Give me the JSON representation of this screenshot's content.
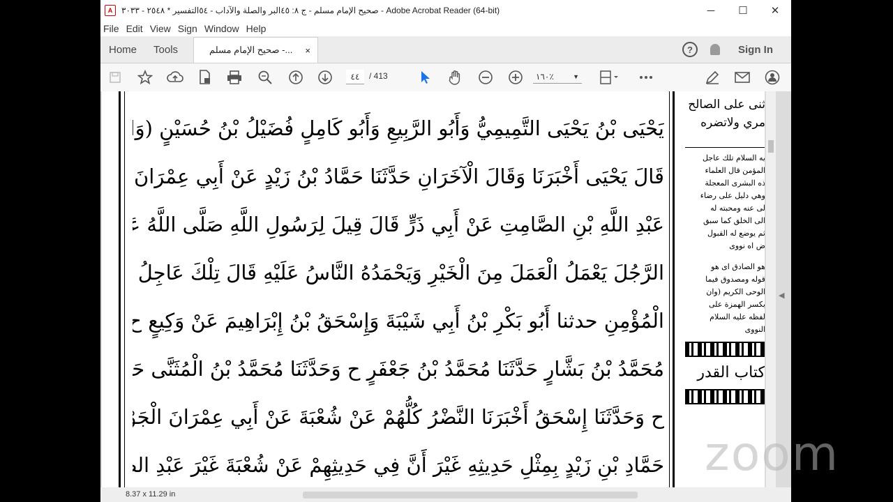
{
  "window": {
    "title": "صحيح الإمام مسلم - ج ٨: ٤٥البر والصلة والآداب - ٥٤التفسير * ٢٥٤٨ - ٣٠٣٣ - Adobe Acrobat Reader (64-bit)",
    "app_icon": "pdf-icon",
    "minimize": "─",
    "maximize": "☐",
    "close": "✕"
  },
  "menu": [
    "File",
    "Edit",
    "View",
    "Sign",
    "Window",
    "Help"
  ],
  "tabs": {
    "home": "Home",
    "tools": "Tools",
    "document": "صحيح الإمام مسلم -...",
    "document_close": "×"
  },
  "account": {
    "help": "?",
    "sign_in": "Sign In"
  },
  "toolbar": {
    "current_page": "٤٤",
    "page_total": "/ 413",
    "zoom": "١٦٠٪"
  },
  "status": {
    "dimensions": "8.37 x 11.29 in"
  },
  "watermark": "zoom",
  "document": {
    "lines": [
      "يَحْيَى بْنُ يَحْيَى التَّمِيمِيُّ وَأَبُو الرَّبِيعِ وَأَبُو كَامِلٍ فُضَيْلُ بْنُ حُسَيْنٍ (وَاللَّفْظُ لِيَحْيَى)",
      "قَالَ يَحْيَى أَخْبَرَنَا وَقَالَ الْآخَرَانِ حَدَّثَنَا حَمَّادُ بْنُ زَيْدٍ عَنْ أَبِي عِمْرَانَ الْجَوْنِيِّ عَنْ",
      "عَبْدِ اللَّهِ بْنِ الصَّامِتِ عَنْ أَبِي ذَرٍّ قَالَ قِيلَ لِرَسُولِ اللَّهِ صَلَّى اللَّهُ عَلَيْهِ وَسَلَّمَ أَرَأَيْتَ",
      "الرَّجُلَ يَعْمَلُ الْعَمَلَ مِنَ الْخَيْرِ وَيَحْمَدُهُ النَّاسُ عَلَيْهِ قَالَ تِلْكَ عَاجِلُ بُشْرَى",
      "الْمُؤْمِنِ حدثنا أَبُو بَكْرِ بْنُ أَبِي شَيْبَةَ وَإِسْحَقُ بْنُ إِبْرَاهِيمَ عَنْ وَكِيعٍ ح وَحَدَّثَنَا",
      "مُحَمَّدُ بْنُ بَشَّارٍ حَدَّثَنَا مُحَمَّدُ بْنُ جَعْفَرٍ ح وَحَدَّثَنَا مُحَمَّدُ بْنُ الْمُثَنَّى حَدَّثَنِي عَبْدُ الصَّمَدِ",
      "ح وَحَدَّثَنَا إِسْحَقُ أَخْبَرَنَا النَّضْرُ كُلُّهُمْ عَنْ شُعْبَةَ عَنْ أَبِي عِمْرَانَ الْجَوْنِيِّ بِإِسْنَادِ",
      "حَمَّادِ بْنِ زَيْدٍ بِمِثْلِ حَدِيثِهِ غَيْرَ أَنَّ فِي حَدِيثِهِمْ عَنْ شُعْبَةَ غَيْرَ عَبْدِ الصَّمَدِ وَيُحِبُّهُ"
    ],
    "sidebar_top": [
      "ثنى على الصالح",
      "مري ولاتضره"
    ],
    "sidebar_notes": [
      "يه السلام تلك عاجل",
      "المؤمن قال العلماء",
      "ذه البشرى المعجلة",
      "وهي دليل على رضاء",
      "لى عنه ومحبته له",
      "الى الخلق كما سبق",
      "ثم يوضع له القبول",
      "ض اه نووى"
    ],
    "sidebar_notes2": [
      "هو الصادق اى هو",
      "قوله ومصدوق فيما",
      "الوحى الكريم (وان",
      "بكسر الهمزة على",
      "لفظه عليه السلام",
      "النووى"
    ],
    "sidebar_title": "كتاب القدر"
  }
}
